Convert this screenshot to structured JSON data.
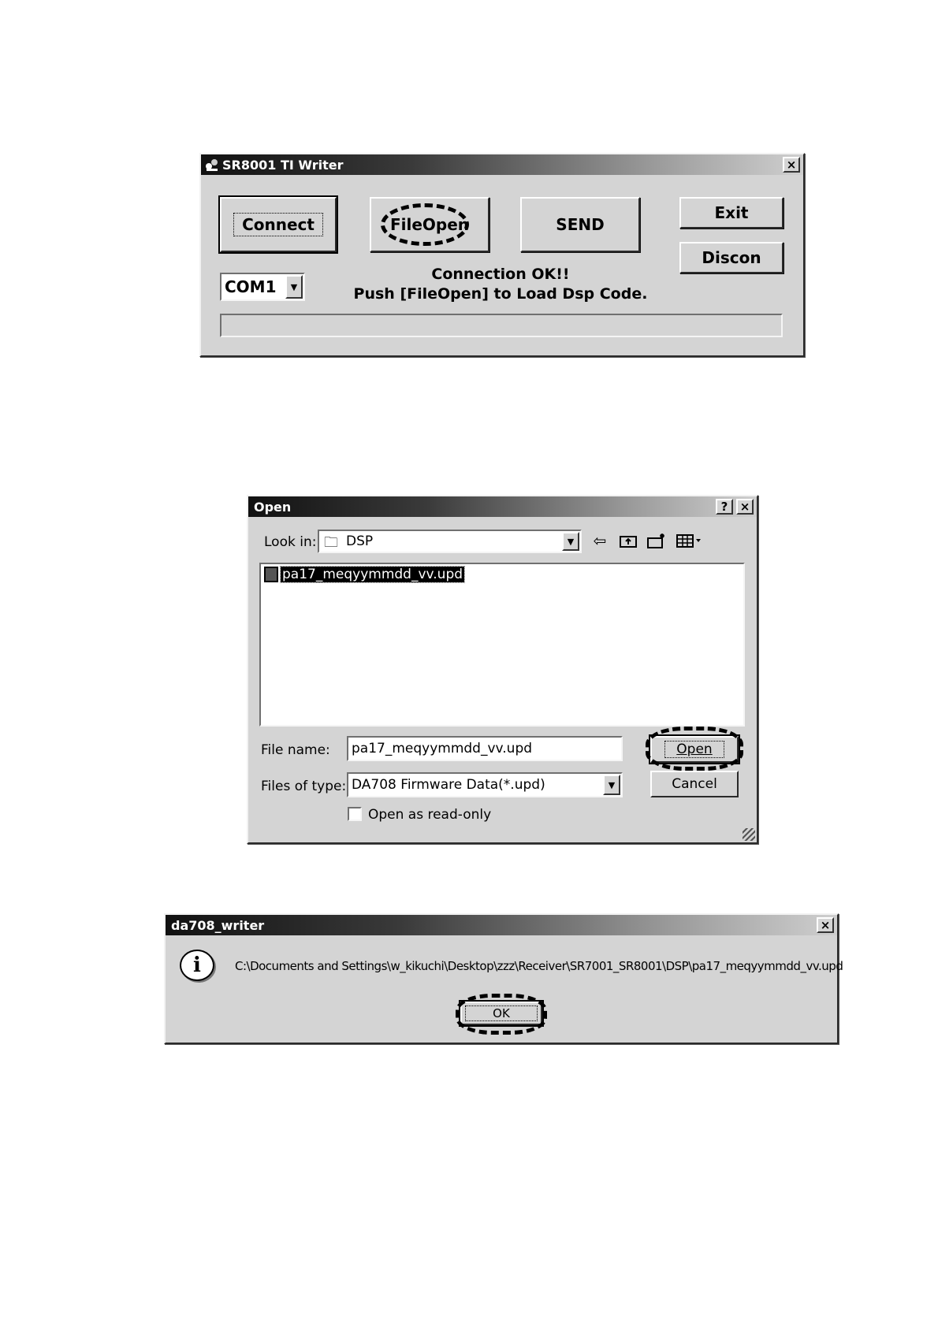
{
  "writer": {
    "title": "SR8001 TI Writer",
    "close_glyph": "×",
    "connect_label": "Connect",
    "fileopen_label": "FileOpen",
    "send_label": "SEND",
    "exit_label": "Exit",
    "discon_label": "Discon",
    "port_value": "COM1",
    "status_line1": "Connection OK!!",
    "status_line2": "Push [FileOpen] to Load Dsp Code."
  },
  "open_dialog": {
    "title": "Open",
    "help_glyph": "?",
    "close_glyph": "×",
    "look_in_label": "Look in:",
    "look_in_value": "DSP",
    "files": [
      "pa17_meqyymmdd_vv.upd"
    ],
    "file_name_label": "File name:",
    "file_name_value": "pa17_meqyymmdd_vv.upd",
    "file_type_label": "Files of type:",
    "file_type_value": "DA708 Firmware Data(*.upd)",
    "open_label": "Open",
    "cancel_label": "Cancel",
    "readonly_label": "Open as read-only",
    "icons": [
      "back-icon",
      "up-folder-icon",
      "new-folder-icon",
      "view-menu-icon"
    ]
  },
  "message_box": {
    "title": "da708_writer",
    "close_glyph": "×",
    "info_glyph": "i",
    "message": "C:\\Documents and Settings\\w_kikuchi\\Desktop\\zzz\\Receiver\\SR7001_SR8001\\DSP\\pa17_meqyymmdd_vv.upd",
    "ok_label": "OK"
  },
  "colors": {
    "dialog_bg": "#d4d4d4",
    "title_dark": "#111111",
    "highlight": "#000000"
  }
}
